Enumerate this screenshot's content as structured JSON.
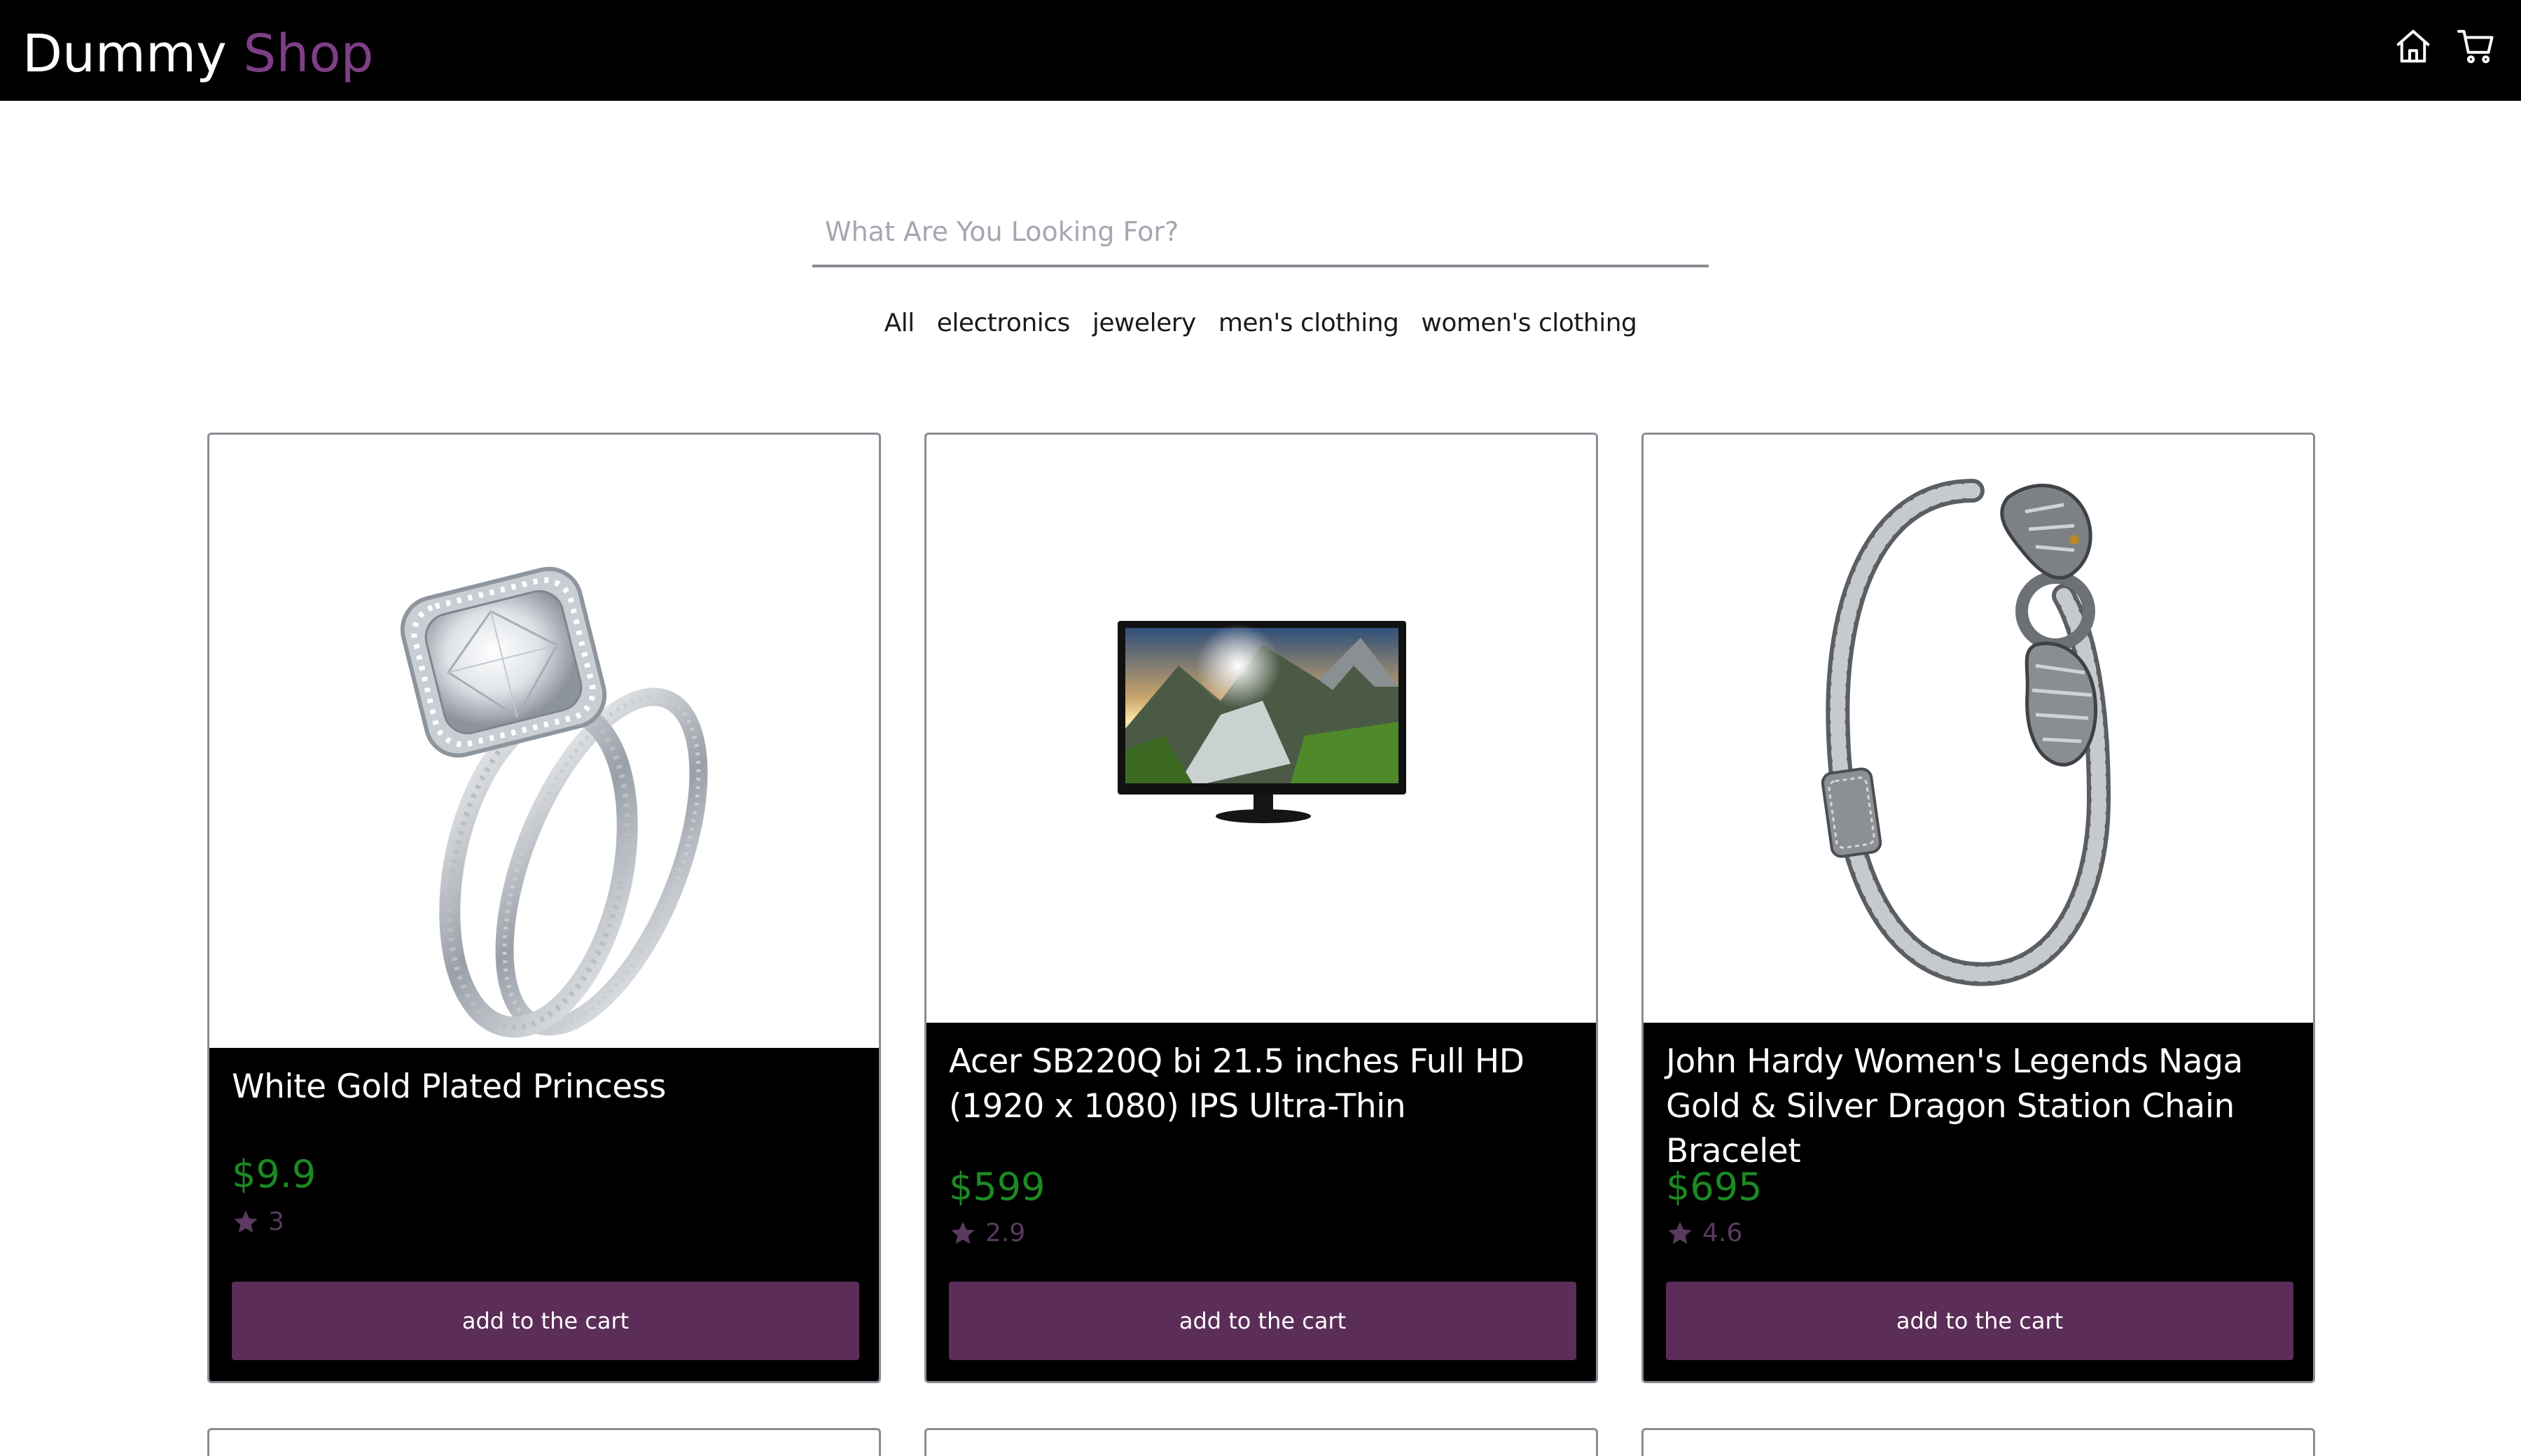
{
  "header": {
    "brand_first": "Dummy",
    "brand_second": "Shop",
    "home_icon": "home-icon",
    "cart_icon": "cart-icon"
  },
  "search": {
    "placeholder": "What Are You Looking For?",
    "value": ""
  },
  "categories": [
    "All",
    "electronics",
    "jewelery",
    "men's clothing",
    "women's clothing"
  ],
  "colors": {
    "header_bg": "#000000",
    "brand_accent": "#7e3f86",
    "price": "#1b8a23",
    "rating": "#5a3a60",
    "button_bg": "#5c2d59"
  },
  "products": [
    {
      "title": "White Gold Plated Princess",
      "price": "$9.9",
      "rating": "3",
      "rating_icon": "star-icon",
      "button": "add to the cart",
      "image": "ring-product-image"
    },
    {
      "title": "Acer SB220Q bi 21.5 inches Full HD (1920 x 1080) IPS Ultra-Thin",
      "price": "$599",
      "rating": "2.9",
      "rating_icon": "star-icon",
      "button": "add to the cart",
      "image": "monitor-product-image"
    },
    {
      "title": "John Hardy Women's Legends Naga Gold & Silver Dragon Station Chain Bracelet",
      "price": "$695",
      "rating": "4.6",
      "rating_icon": "star-icon",
      "button": "add to the cart",
      "image": "bracelet-product-image"
    }
  ]
}
